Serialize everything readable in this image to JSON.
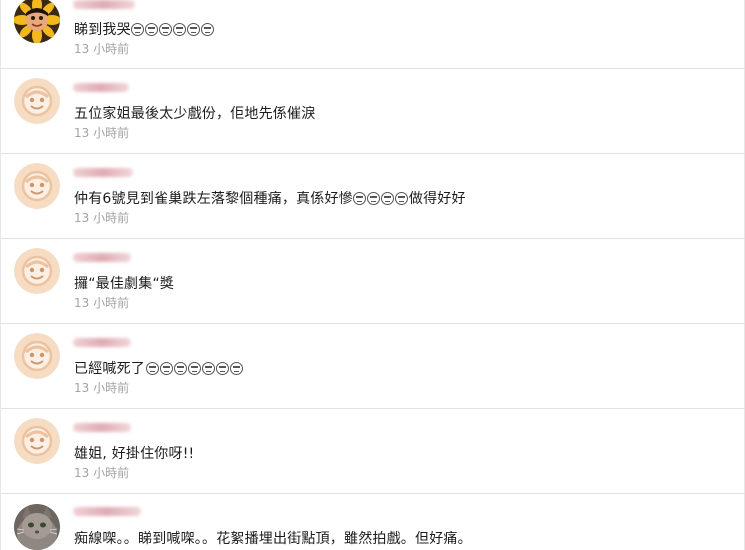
{
  "comments": [
    {
      "text": "睇到我哭",
      "emoji_count": 6,
      "time": "13 小時前",
      "avatar": "sunflower-photo-icon"
    },
    {
      "text": "五位家姐最後太少戲份，佢地先係催淚",
      "emoji_count": 0,
      "time": "13 小時前",
      "avatar": "default-face-icon"
    },
    {
      "text": "仲有6號見到雀巢跌左落黎個種痛，真係好慘",
      "emoji_count": 4,
      "text_after": "做得好好",
      "time": "13 小時前",
      "avatar": "default-face-icon"
    },
    {
      "text": "攞“最佳劇集“獎",
      "emoji_count": 0,
      "time": "13 小時前",
      "avatar": "default-face-icon"
    },
    {
      "text": "已經喊死了",
      "emoji_count": 7,
      "time": "13 小時前",
      "avatar": "default-face-icon"
    },
    {
      "text": "雄姐, 好掛住你呀!!",
      "emoji_count": 0,
      "time": "13 小時前",
      "avatar": "default-face-icon"
    },
    {
      "text": "痴線㗎。。睇到喊㗎。。花絮播埋出街點頂，雖然拍戲。但好痛。",
      "emoji_count": 0,
      "time": "",
      "avatar": "cat-photo-icon"
    }
  ],
  "colors": {
    "face_bg": "#f7dcc4",
    "face_ring": "#ecc29f",
    "time": "#a3a3a3"
  }
}
